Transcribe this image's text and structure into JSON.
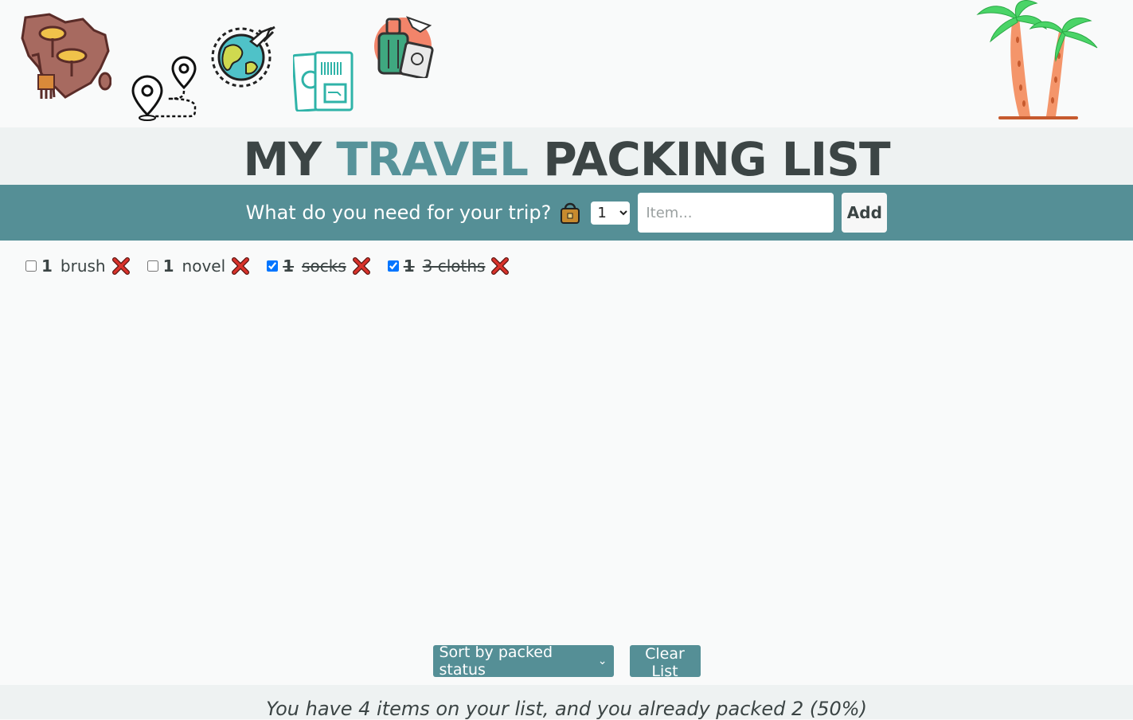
{
  "title": {
    "part1": "MY",
    "accent": "TRAVEL",
    "part2": "PACKING LIST"
  },
  "form": {
    "prompt": "What do you need for your trip?",
    "quantity_selected": "1",
    "item_placeholder": "Item...",
    "add_label": "Add"
  },
  "items": [
    {
      "qty": "1",
      "description": "brush",
      "packed": false
    },
    {
      "qty": "1",
      "description": "novel",
      "packed": false
    },
    {
      "qty": "1",
      "description": "socks",
      "packed": true
    },
    {
      "qty": "1",
      "description": "3 cloths",
      "packed": true
    }
  ],
  "actions": {
    "sort_label": "Sort by packed status",
    "clear_label": "Clear List"
  },
  "footer": {
    "stats": "You have 4 items on your list, and you already packed 2 (50%)"
  },
  "colors": {
    "accent": "#57939a",
    "bar": "#558f96",
    "title_band": "#eef2f2",
    "delete": "#d9322b"
  },
  "icons": [
    "africa-map-icon",
    "route-pins-icon",
    "globe-plane-icon",
    "passport-tickets-icon",
    "luggage-icon",
    "palm-trees-icon",
    "bag-icon",
    "delete-x-icon"
  ]
}
